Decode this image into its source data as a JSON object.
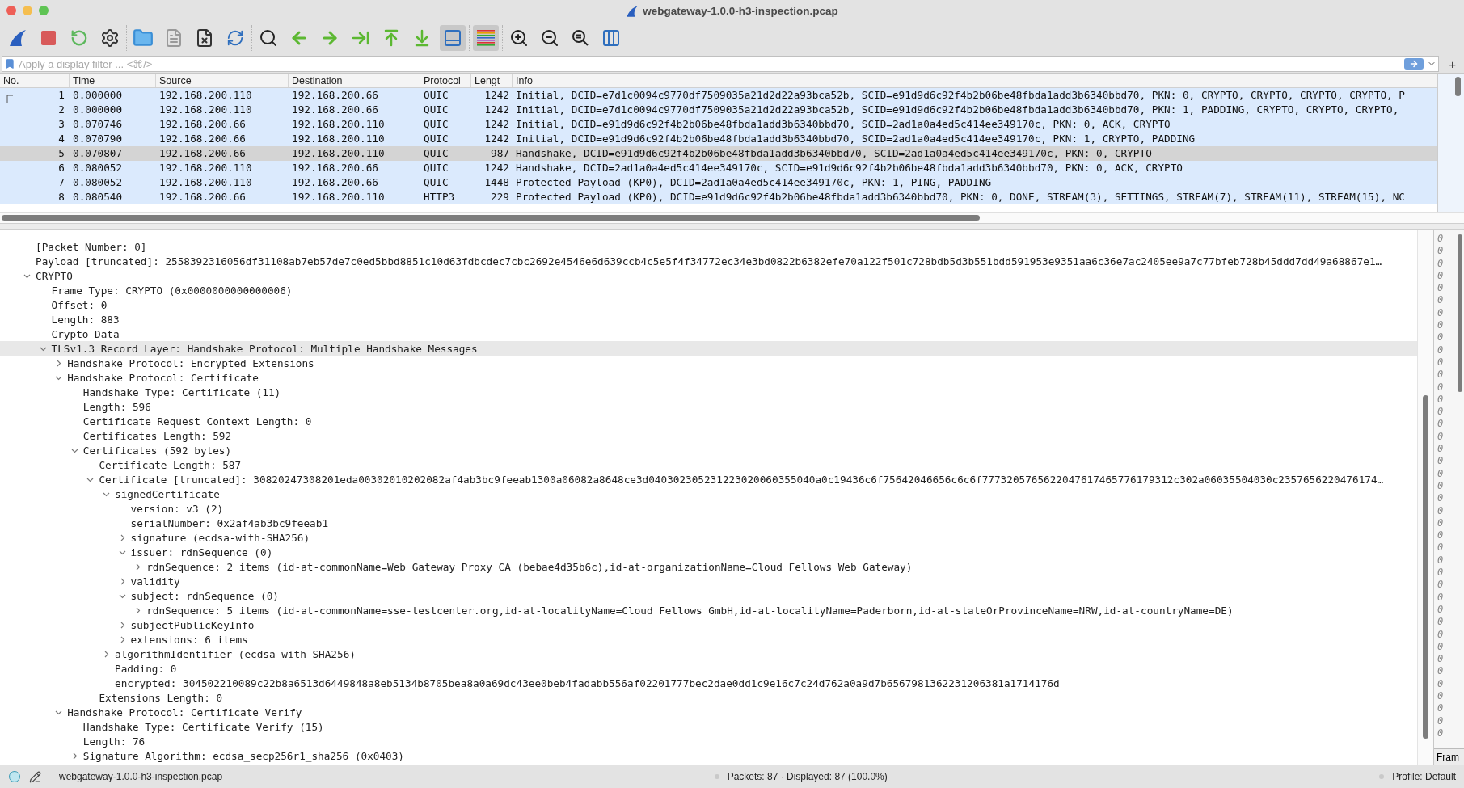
{
  "window": {
    "title": "webgateway-1.0.0-h3-inspection.pcap"
  },
  "toolbar": {
    "groups": [
      {
        "buttons": [
          {
            "kind": "shark",
            "pressed": false
          },
          {
            "kind": "stop",
            "pressed": false
          },
          {
            "kind": "restart",
            "pressed": false
          },
          {
            "kind": "options",
            "pressed": false
          }
        ]
      },
      {
        "buttons": [
          {
            "kind": "open",
            "pressed": false
          },
          {
            "kind": "file",
            "pressed": false
          },
          {
            "kind": "close",
            "pressed": false
          },
          {
            "kind": "reload",
            "pressed": false
          }
        ]
      },
      {
        "buttons": [
          {
            "kind": "find",
            "pressed": false
          },
          {
            "kind": "back",
            "pressed": false
          },
          {
            "kind": "forward",
            "pressed": false
          },
          {
            "kind": "goto",
            "pressed": false
          },
          {
            "kind": "first",
            "pressed": false
          },
          {
            "kind": "last",
            "pressed": false
          },
          {
            "kind": "autoscroll",
            "pressed": true
          }
        ]
      },
      {
        "buttons": [
          {
            "kind": "colorize",
            "pressed": true
          }
        ]
      },
      {
        "buttons": [
          {
            "kind": "zoomin",
            "pressed": false
          },
          {
            "kind": "zoomout",
            "pressed": false
          },
          {
            "kind": "zoomreset",
            "pressed": false
          },
          {
            "kind": "resize",
            "pressed": false
          }
        ]
      }
    ]
  },
  "filter": {
    "placeholder": "Apply a display filter ... <⌘/>",
    "add_button": "+"
  },
  "packet_list": {
    "columns": [
      "No.",
      "Time",
      "Source",
      "Destination",
      "Protocol",
      "Lengt",
      "Info"
    ],
    "rows": [
      {
        "no": "1",
        "time": "0.000000",
        "source": "192.168.200.110",
        "destination": "192.168.200.66",
        "protocol": "QUIC",
        "length": "1242",
        "info": "Initial, DCID=e7d1c0094c9770df7509035a21d2d22a93bca52b, SCID=e91d9d6c92f4b2b06be48fbda1add3b6340bbd70, PKN: 0, CRYPTO, CRYPTO, CRYPTO, CRYPTO, P",
        "selected": false,
        "marker": true
      },
      {
        "no": "2",
        "time": "0.000000",
        "source": "192.168.200.110",
        "destination": "192.168.200.66",
        "protocol": "QUIC",
        "length": "1242",
        "info": "Initial, DCID=e7d1c0094c9770df7509035a21d2d22a93bca52b, SCID=e91d9d6c92f4b2b06be48fbda1add3b6340bbd70, PKN: 1, PADDING, CRYPTO, CRYPTO, CRYPTO,",
        "selected": false,
        "marker": false
      },
      {
        "no": "3",
        "time": "0.070746",
        "source": "192.168.200.66",
        "destination": "192.168.200.110",
        "protocol": "QUIC",
        "length": "1242",
        "info": "Initial, DCID=e91d9d6c92f4b2b06be48fbda1add3b6340bbd70, SCID=2ad1a0a4ed5c414ee349170c, PKN: 0, ACK, CRYPTO",
        "selected": false,
        "marker": false
      },
      {
        "no": "4",
        "time": "0.070790",
        "source": "192.168.200.66",
        "destination": "192.168.200.110",
        "protocol": "QUIC",
        "length": "1242",
        "info": "Initial, DCID=e91d9d6c92f4b2b06be48fbda1add3b6340bbd70, SCID=2ad1a0a4ed5c414ee349170c, PKN: 1, CRYPTO, PADDING",
        "selected": false,
        "marker": false
      },
      {
        "no": "5",
        "time": "0.070807",
        "source": "192.168.200.66",
        "destination": "192.168.200.110",
        "protocol": "QUIC",
        "length": "987",
        "info": "Handshake, DCID=e91d9d6c92f4b2b06be48fbda1add3b6340bbd70, SCID=2ad1a0a4ed5c414ee349170c, PKN: 0, CRYPTO",
        "selected": true,
        "marker": false
      },
      {
        "no": "6",
        "time": "0.080052",
        "source": "192.168.200.110",
        "destination": "192.168.200.66",
        "protocol": "QUIC",
        "length": "1242",
        "info": "Handshake, DCID=2ad1a0a4ed5c414ee349170c, SCID=e91d9d6c92f4b2b06be48fbda1add3b6340bbd70, PKN: 0, ACK, CRYPTO",
        "selected": false,
        "marker": false
      },
      {
        "no": "7",
        "time": "0.080052",
        "source": "192.168.200.110",
        "destination": "192.168.200.66",
        "protocol": "QUIC",
        "length": "1448",
        "info": "Protected Payload (KP0), DCID=2ad1a0a4ed5c414ee349170c, PKN: 1, PING, PADDING",
        "selected": false,
        "marker": false
      },
      {
        "no": "8",
        "time": "0.080540",
        "source": "192.168.200.66",
        "destination": "192.168.200.110",
        "protocol": "HTTP3",
        "length": "229",
        "info": "Protected Payload (KP0), DCID=e91d9d6c92f4b2b06be48fbda1add3b6340bbd70, PKN: 0, DONE, STREAM(3), SETTINGS, STREAM(7), STREAM(11), STREAM(15), NC",
        "selected": false,
        "marker": false
      }
    ]
  },
  "details": [
    {
      "label": "[Packet Number: 0]",
      "selected": false
    },
    {
      "label": "Payload [truncated]: 2558392316056df31108ab7eb57de7c0ed5bbd8851c10d63fdbcdec7cbc2692e4546e6d639ccb4c5e5f4f34772ec34e3bd0822b6382efe70a122f501c728bdb5d3b551bdd591953e9351aa6c36e7ac2405ee9a7c77bfeb728b45ddd7dd49a68867e1…",
      "selected": false
    },
    {
      "label": "CRYPTO",
      "expanded": true,
      "selected": false,
      "children": [
        {
          "label": "Frame Type: CRYPTO (0x0000000000000006)",
          "selected": false
        },
        {
          "label": "Offset: 0",
          "selected": false
        },
        {
          "label": "Length: 883",
          "selected": false
        },
        {
          "label": "Crypto Data",
          "selected": false
        },
        {
          "label": "TLSv1.3 Record Layer: Handshake Protocol: Multiple Handshake Messages",
          "expanded": true,
          "selected": true,
          "children": [
            {
              "label": "Handshake Protocol: Encrypted Extensions",
              "expanded": false,
              "selected": false
            },
            {
              "label": "Handshake Protocol: Certificate",
              "expanded": true,
              "selected": false,
              "children": [
                {
                  "label": "Handshake Type: Certificate (11)",
                  "selected": false
                },
                {
                  "label": "Length: 596",
                  "selected": false
                },
                {
                  "label": "Certificate Request Context Length: 0",
                  "selected": false
                },
                {
                  "label": "Certificates Length: 592",
                  "selected": false
                },
                {
                  "label": "Certificates (592 bytes)",
                  "expanded": true,
                  "selected": false,
                  "children": [
                    {
                      "label": "Certificate Length: 587",
                      "selected": false
                    },
                    {
                      "label": "Certificate [truncated]: 30820247308201eda00302010202082af4ab3bc9feeab1300a06082a8648ce3d040302305231223020060355040a0c19436c6f75642046656c6c6f7773205765622047617465776179312c302a06035504030c2357656220476174…",
                      "expanded": true,
                      "selected": false,
                      "children": [
                        {
                          "label": "signedCertificate",
                          "expanded": true,
                          "selected": false,
                          "children": [
                            {
                              "label": "version: v3 (2)",
                              "selected": false
                            },
                            {
                              "label": "serialNumber: 0x2af4ab3bc9feeab1",
                              "selected": false
                            },
                            {
                              "label": "signature (ecdsa-with-SHA256)",
                              "expanded": false,
                              "selected": false
                            },
                            {
                              "label": "issuer: rdnSequence (0)",
                              "expanded": true,
                              "selected": false,
                              "children": [
                                {
                                  "label": "rdnSequence: 2 items (id-at-commonName=Web Gateway Proxy CA (bebae4d35b6c),id-at-organizationName=Cloud Fellows Web Gateway)",
                                  "expanded": false,
                                  "selected": false
                                }
                              ]
                            },
                            {
                              "label": "validity",
                              "expanded": false,
                              "selected": false
                            },
                            {
                              "label": "subject: rdnSequence (0)",
                              "expanded": true,
                              "selected": false,
                              "children": [
                                {
                                  "label": "rdnSequence: 5 items (id-at-commonName=sse-testcenter.org,id-at-localityName=Cloud Fellows GmbH,id-at-localityName=Paderborn,id-at-stateOrProvinceName=NRW,id-at-countryName=DE)",
                                  "expanded": false,
                                  "selected": false
                                }
                              ]
                            },
                            {
                              "label": "subjectPublicKeyInfo",
                              "expanded": false,
                              "selected": false
                            },
                            {
                              "label": "extensions: 6 items",
                              "expanded": false,
                              "selected": false
                            }
                          ]
                        },
                        {
                          "label": "algorithmIdentifier (ecdsa-with-SHA256)",
                          "expanded": false,
                          "selected": false
                        },
                        {
                          "label": "Padding: 0",
                          "selected": false
                        },
                        {
                          "label": "encrypted: 304502210089c22b8a6513d6449848a8eb5134b8705bea8a0a69dc43ee0beb4fadabb556af02201777bec2dae0dd1c9e16c7c24d762a0a9d7b6567981362231206381a1714176d",
                          "selected": false
                        }
                      ]
                    },
                    {
                      "label": "Extensions Length: 0",
                      "selected": false
                    }
                  ]
                }
              ]
            },
            {
              "label": "Handshake Protocol: Certificate Verify",
              "expanded": true,
              "selected": false,
              "children": [
                {
                  "label": "Handshake Type: Certificate Verify (15)",
                  "selected": false
                },
                {
                  "label": "Length: 76",
                  "selected": false
                },
                {
                  "label": "Signature Algorithm: ecdsa_secp256r1_sha256 (0x0403)",
                  "expanded": false,
                  "selected": false
                }
              ]
            }
          ]
        }
      ]
    }
  ],
  "bytes_pane": {
    "digits": [
      "0",
      "0",
      "0",
      "0",
      "0",
      "0",
      "0",
      "0",
      "0",
      "0",
      "0",
      "0",
      "0",
      "0",
      "0",
      "0",
      "0",
      "0",
      "0",
      "0",
      "0",
      "0",
      "0",
      "0",
      "0",
      "0",
      "0",
      "0",
      "0",
      "0",
      "0",
      "0",
      "0",
      "0",
      "0",
      "0",
      "0",
      "0",
      "0",
      "0",
      "0"
    ],
    "tab": "Fram"
  },
  "status_bar": {
    "file": "webgateway-1.0.0-h3-inspection.pcap",
    "packets": "Packets: 87 · Displayed: 87 (100.0%)",
    "profile": "Profile: Default"
  }
}
